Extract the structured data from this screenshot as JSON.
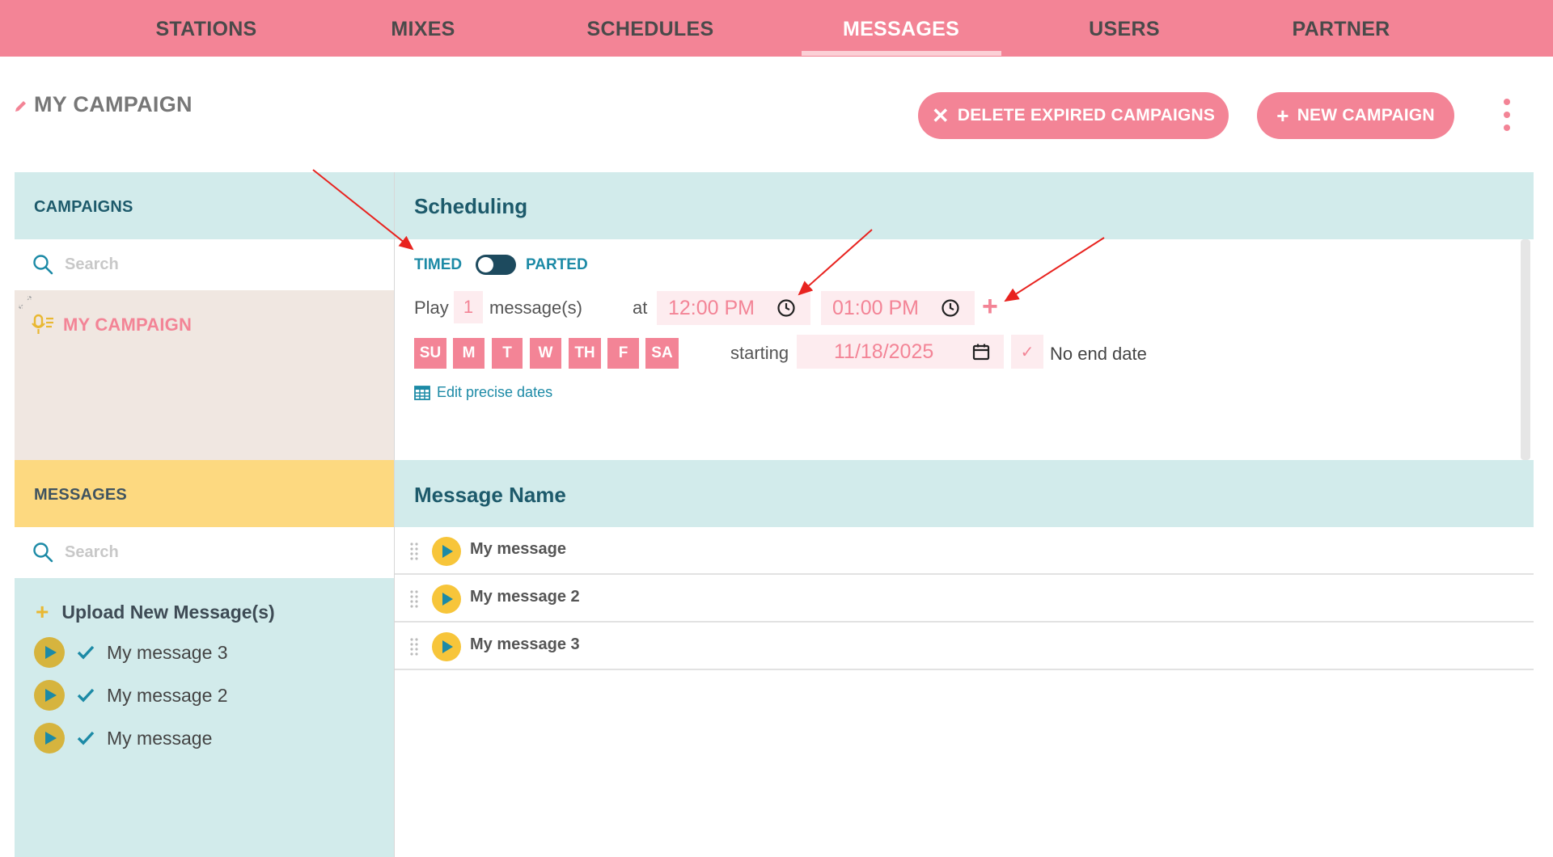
{
  "nav": {
    "items": [
      {
        "label": "STATIONS",
        "active": false
      },
      {
        "label": "MIXES",
        "active": false
      },
      {
        "label": "SCHEDULES",
        "active": false
      },
      {
        "label": "MESSAGES",
        "active": true
      },
      {
        "label": "USERS",
        "active": false
      },
      {
        "label": "PARTNER",
        "active": false
      }
    ]
  },
  "header": {
    "title": "MY CAMPAIGN",
    "delete_expired_label": "DELETE EXPIRED CAMPAIGNS",
    "new_campaign_label": "NEW CAMPAIGN"
  },
  "campaigns": {
    "title": "CAMPAIGNS",
    "search_placeholder": "Search",
    "items": [
      {
        "label": "MY CAMPAIGN"
      }
    ]
  },
  "messages_library": {
    "title": "MESSAGES",
    "search_placeholder": "Search",
    "upload_label": "Upload New Message(s)",
    "items": [
      {
        "label": "My message 3"
      },
      {
        "label": "My message 2"
      },
      {
        "label": "My message"
      }
    ]
  },
  "scheduling": {
    "title": "Scheduling",
    "mode_left": "TIMED",
    "mode_right": "PARTED",
    "play_label": "Play",
    "play_count": "1",
    "messages_unit": "message(s)",
    "at_label": "at",
    "start_time": "12:00 PM",
    "end_time": "01:00 PM",
    "days": [
      "SU",
      "M",
      "T",
      "W",
      "TH",
      "F",
      "SA"
    ],
    "starting_label": "starting",
    "start_date": "11/18/2025",
    "no_end_date_label": "No end date",
    "edit_dates_label": "Edit precise dates"
  },
  "message_table": {
    "header": "Message Name",
    "rows": [
      {
        "name": "My message"
      },
      {
        "name": "My message 2"
      },
      {
        "name": "My message 3"
      }
    ]
  },
  "colors": {
    "brand_pink": "#f38496",
    "panel_teal": "#d2ebeb",
    "messages_yellow": "#fdd980",
    "accent_teal": "#1c8aa6",
    "annotation_red": "#e8231f"
  }
}
